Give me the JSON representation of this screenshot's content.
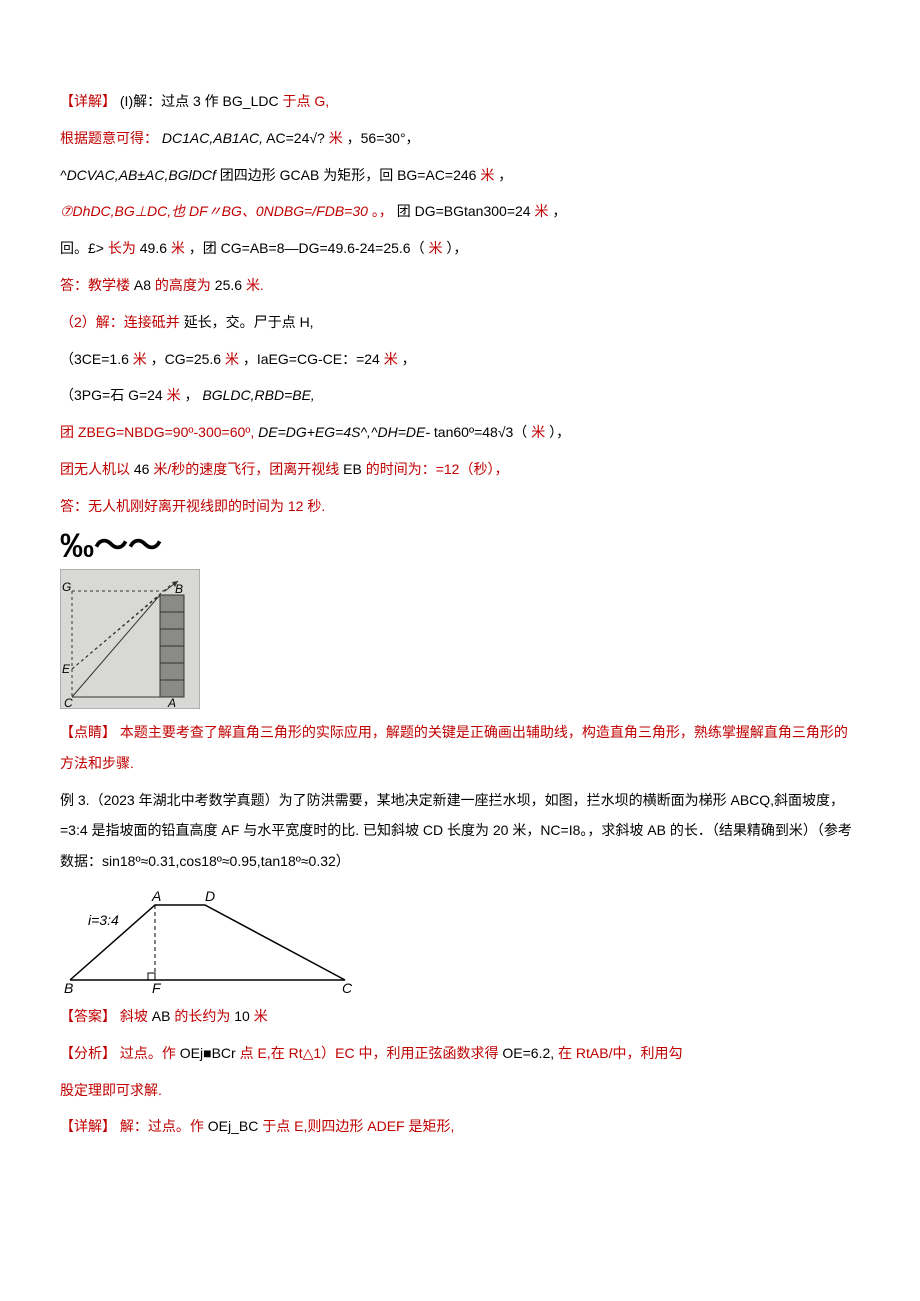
{
  "p1_a": "【详解】",
  "p1_b": "(I)解：过点 3 作 BG_LDC ",
  "p1_c": "于点 G,",
  "p2_a": "根据题意可得：",
  "p2_b": "DC1AC,AB1AC,",
  "p2_c": "AC=24√?",
  "p2_d": "米",
  "p2_e": "，56=30°，",
  "p3_a": "^DCVAC,AB±AC,BGlDCf",
  "p3_b": "团四边形 GCAB 为矩形，回 BG=AC=246",
  "p3_c": " 米",
  "p3_d": "，",
  "p4_a": "⑦DhDC,BG⊥DC,也 DF〃BG、0NDBG=/FDB=30",
  "p4_b": "。，",
  "p4_c": "团 DG=BGtan300=24",
  "p4_d": " 米",
  "p4_e": "，",
  "p5_a": "回。£>",
  "p5_b": "长为 ",
  "p5_c": "49.6",
  "p5_d": " 米",
  "p5_e": "，团 CG=AB=8—DG=49.6-24=25.6（",
  "p5_f": "米",
  "p5_g": "），",
  "p6_a": "答：教学楼 ",
  "p6_b": "A8",
  "p6_c": " 的高度为 ",
  "p6_d": "25.6",
  "p6_e": " 米.",
  "p7_a": "（2）解：连接砥并",
  "p7_b": "延长，交。尸于点 H,",
  "p8_a": "（3CE=1.6 ",
  "p8_b": "米",
  "p8_c": "，CG=25.6 ",
  "p8_d": "米",
  "p8_e": "，IaEG=CG-CE：=24 ",
  "p8_f": "米",
  "p8_g": "，",
  "p9_a": "（3PG=石 G=24 ",
  "p9_b": "米",
  "p9_c": "，",
  "p9_d": "BGLDC,RBD=BE,",
  "p10_a": "团 ZBEG=NBDG=90º-300=60º,",
  "p10_b": "DE=DG+EG=4S^,^DH=DE-",
  "p10_c": "tan60º=48√3（",
  "p10_d": "米",
  "p10_e": "），",
  "p11_a": "团无人机以 ",
  "p11_b": "46",
  "p11_c": " 米/秒的速度飞行，团离开视线 ",
  "p11_d": "EB",
  "p11_e": " 的时间为：=12（秒），",
  "p12": "答：无人机刚好离开视线即的时间为 12 秒.",
  "permille": "‰～～",
  "fig1": {
    "G": "G",
    "E": "E",
    "C": "C",
    "A": "A",
    "B": "B"
  },
  "p13_a": "【点睛】",
  "p13_b": "本题主要考查了解直角三角形的实际应用，解题的关键是正确画出辅助线，构造直角三角形，熟练掌握解直角三角形的方法和步骤.",
  "p14": "例 3.（2023 年湖北中考数学真题）为了防洪需要，某地决定新建一座拦水坝，如图，拦水坝的横断面为梯形 ABCQ,斜面坡度，=3:4 是指坡面的铅直高度 AF 与水平宽度时的比. 已知斜坡 CD 长度为 20 米，NC=I8。，求斜坡 AB 的长．（结果精确到米）（参考数据：sin18º≈0.31,cos18º≈0.95,tan18º≈0.32）",
  "fig2": {
    "i": "i=3:4",
    "A": "A",
    "D": "D",
    "B": "B",
    "F": "F",
    "C": "C"
  },
  "p15_a": "【答案】",
  "p15_b": "斜坡 ",
  "p15_c": "AB",
  "p15_d": " 的长约为 ",
  "p15_e": "10",
  "p15_f": " 米",
  "p16_a": "【分析】",
  "p16_b": "过点。作 ",
  "p16_c": "OEj■BCr",
  "p16_d": " 点 E,在 Rt△1）EC 中，利用正弦函数求得 ",
  "p16_e": "OE=6.2,",
  "p16_f": "在 RtAB/中，利用勾",
  "p16_g": "股定理即可求解.",
  "p17_a": "【详解】",
  "p17_b": "解：过点。作 ",
  "p17_c": "OEj_BC",
  "p17_d": " 于点 E,则四边形 ADEF 是矩形,"
}
